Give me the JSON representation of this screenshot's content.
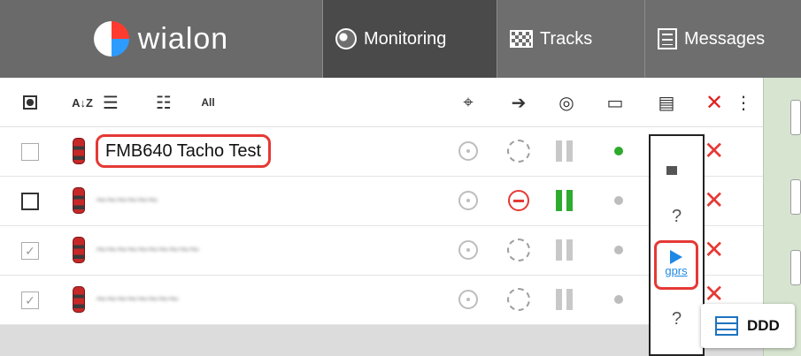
{
  "brand": {
    "logo_text": "wialon"
  },
  "nav": {
    "tabs": [
      {
        "label": "Monitoring",
        "icon": "globe-icon",
        "active": true
      },
      {
        "label": "Tracks",
        "icon": "checkered-flag-icon",
        "active": false
      },
      {
        "label": "Messages",
        "icon": "document-icon",
        "active": false
      }
    ]
  },
  "toolbar": {
    "sort_label": "A↓Z",
    "all_label": "All"
  },
  "units": [
    {
      "name": "FMB640 Tacho Test",
      "checked": false,
      "highlighted": true,
      "visible_name": true,
      "status": "dashed",
      "signal": "gray",
      "dot": "green"
    },
    {
      "name": "",
      "checked": false,
      "highlighted": false,
      "visible_name": false,
      "status": "nogo",
      "signal": "green",
      "dot": "gray"
    },
    {
      "name": "",
      "checked": true,
      "highlighted": false,
      "visible_name": false,
      "status": "dashed",
      "signal": "gray",
      "dot": "gray"
    },
    {
      "name": "",
      "checked": true,
      "highlighted": false,
      "visible_name": false,
      "status": "dashed",
      "signal": "gray",
      "dot": "gray"
    }
  ],
  "popup": {
    "items": [
      "?",
      "?"
    ],
    "play_label": "gprs"
  },
  "ddd": {
    "label": "DDD"
  },
  "colors": {
    "accent_red": "#e53935",
    "link_blue": "#1e88e5",
    "topbar": "#6e6e6e",
    "ok_green": "#2eaa2e"
  }
}
